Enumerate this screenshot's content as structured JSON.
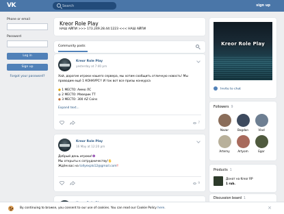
{
  "topbar": {
    "logo": "VK",
    "search_placeholder": "Search",
    "signup": "sign up"
  },
  "login": {
    "phone_label": "Phone or email",
    "password_label": "Password",
    "login_button": "Log in",
    "signup_button": "Sign up",
    "forgot": "Forgot your password?"
  },
  "community": {
    "title": "Kreor Role Play",
    "status": "НАШ АЙПИ >>> 173.249.28.44:1223 <<< НАШ АЙПИ"
  },
  "tabs": {
    "posts": "Community posts"
  },
  "posts": [
    {
      "author": "Kreor Role Play",
      "date": "yesterday at 7:40 pm",
      "lines": [
        "Хай, дорогие игроки нашего сервера, мы хотим сообщить отличную новость! Мы",
        "проводим ещё 1 КОНКУРС!! И так вот все призы конкурса"
      ],
      "prizes": [
        "1 МЕСТО: Аммо ЛС",
        "2 МЕСТО: Мэверик ТТ",
        "3 МЕСТО: 300 AZ Coins"
      ],
      "expand": "Expand text...",
      "views": "7"
    },
    {
      "author": "Kreor Role Play",
      "date": "16 May at 12:20 pm",
      "line1": "Добрый день игроки!",
      "line2": "Мы открыты к сотрудничеству!",
      "line3_prefix": "Ждём вас на ",
      "line3_link": "tollyexplo12@gmail.com",
      "views": "9"
    },
    {
      "author": "Kreor Role Play",
      "date": ""
    }
  ],
  "sidebar": {
    "cover_text": "Kreor Role Play",
    "invite": "Invite to chat",
    "followers_title": "Followers",
    "followers_count": "9",
    "followers": [
      {
        "name": "Nazar",
        "color": "#8a6d5a"
      },
      {
        "name": "Bogdan",
        "color": "#3d4a5e"
      },
      {
        "name": "Vlad",
        "color": "#6e7f92"
      },
      {
        "name": "Artemy",
        "color": "#b8b09a"
      },
      {
        "name": "Artyom",
        "color": "#a86a5c"
      },
      {
        "name": "Egor",
        "color": "#4f5a3e"
      }
    ],
    "products_title": "Products",
    "products_count": "1",
    "product_name": "Донат на Kreor RP",
    "product_price": "1 rub.",
    "discussion_title": "Discussion board",
    "discussion_count": "1"
  },
  "cookie": {
    "text": "By continuing to browse, you consent to our use of cookies. You can read our Cookie Policy ",
    "link": "here",
    "suffix": "."
  },
  "colors": {
    "brand": "#4a76a8",
    "link": "#2a5885",
    "button": "#5181b8"
  }
}
